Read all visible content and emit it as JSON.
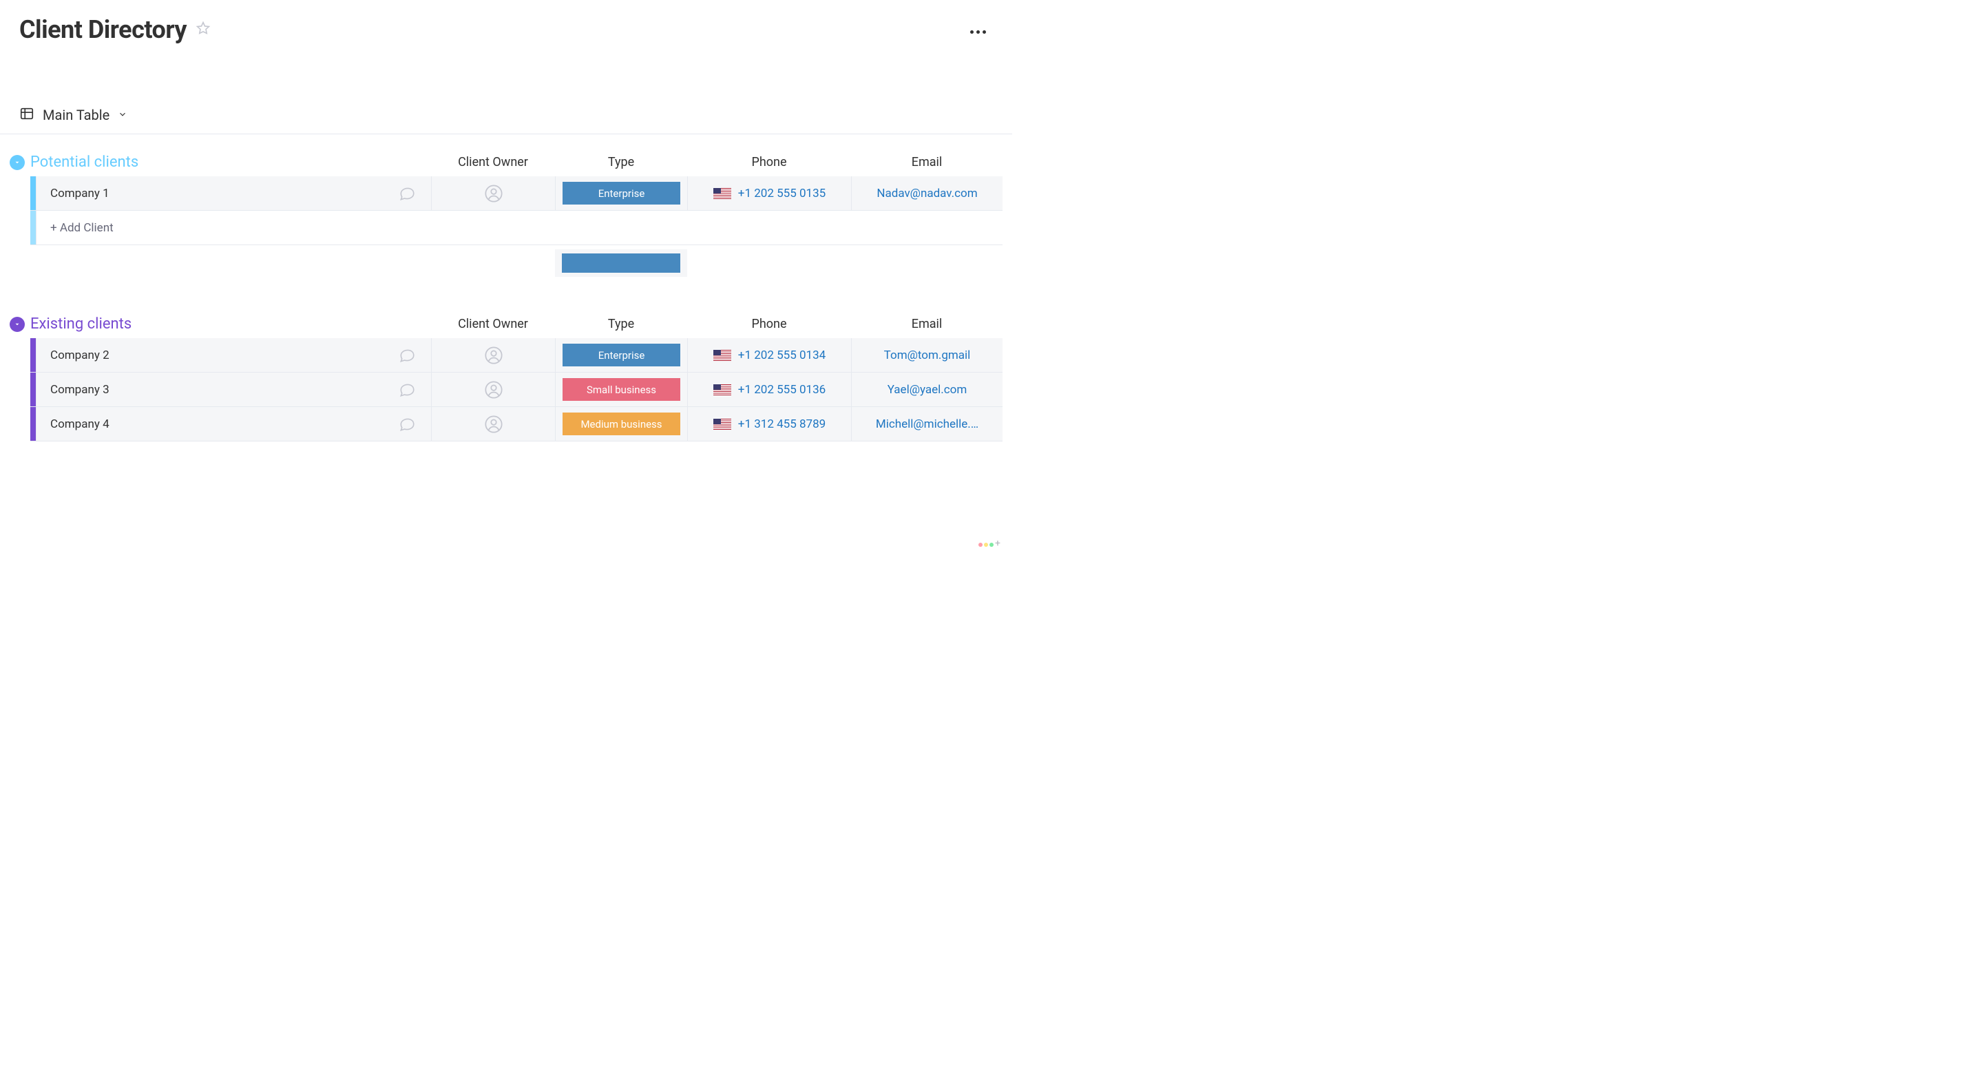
{
  "page": {
    "title": "Client Directory"
  },
  "view": {
    "name": "Main Table"
  },
  "columns": {
    "owner": "Client Owner",
    "type": "Type",
    "phone": "Phone",
    "email": "Email"
  },
  "type_colors": {
    "Enterprise": "#4789bf",
    "Small business": "#e8697d",
    "Medium business": "#f0a94a"
  },
  "groups": [
    {
      "id": "potential",
      "title": "Potential clients",
      "color": "#66ccff",
      "add_label": "+ Add Client",
      "rows": [
        {
          "name": "Company 1",
          "type": "Enterprise",
          "phone": "+1 202 555 0135",
          "flag": "us",
          "email": "Nadav@nadav.com"
        }
      ],
      "summary_color": "#4789bf"
    },
    {
      "id": "existing",
      "title": "Existing clients",
      "color": "#784bd1",
      "rows": [
        {
          "name": "Company 2",
          "type": "Enterprise",
          "phone": "+1 202 555 0134",
          "flag": "us",
          "email": "Tom@tom.gmail"
        },
        {
          "name": "Company 3",
          "type": "Small business",
          "phone": "+1 202 555 0136",
          "flag": "us",
          "email": "Yael@yael.com"
        },
        {
          "name": "Company 4",
          "type": "Medium business",
          "phone": "+1 312 455 8789",
          "flag": "us",
          "email": "Michell@michelle.…"
        }
      ]
    }
  ]
}
